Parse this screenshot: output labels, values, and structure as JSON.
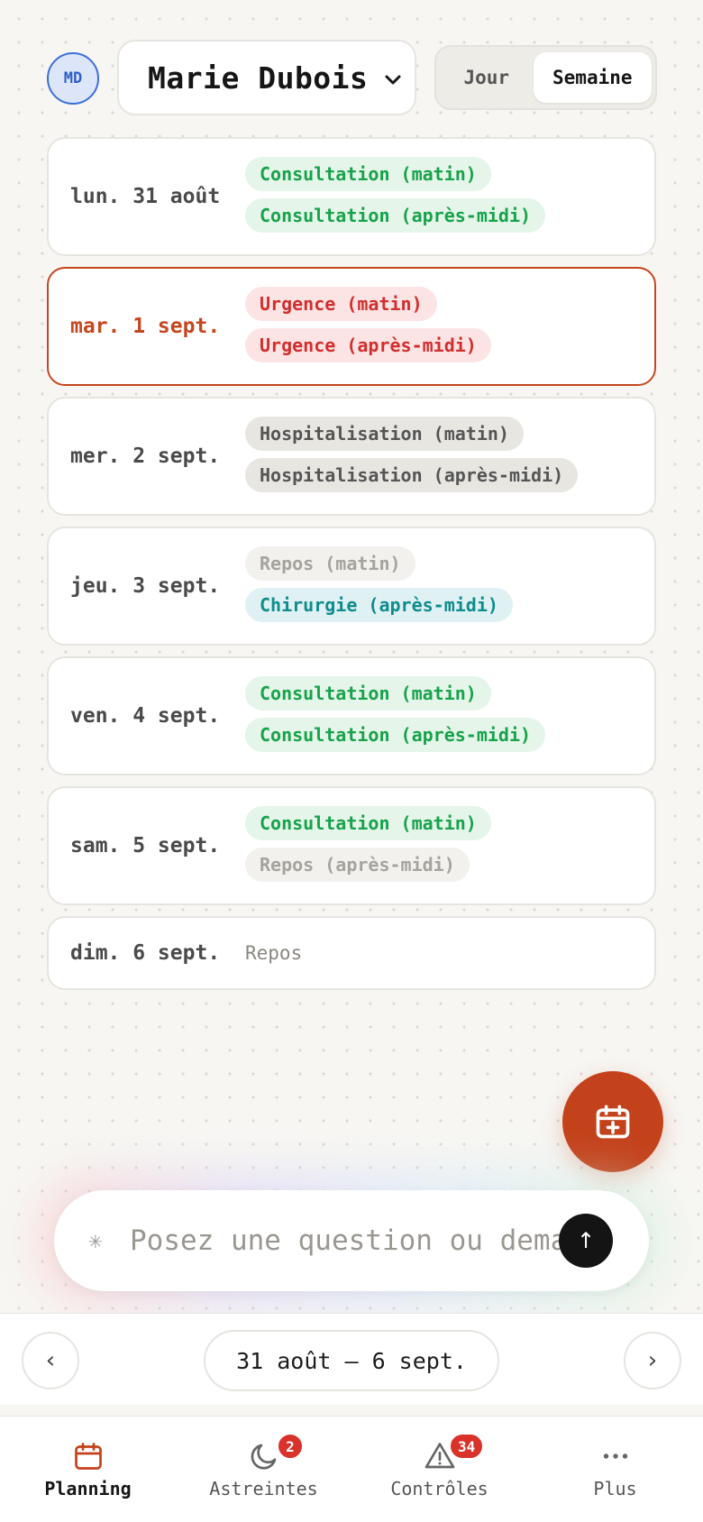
{
  "header": {
    "avatar_initials": "MD",
    "user_name": "Marie Dubois",
    "view_options": {
      "day": "Jour",
      "week": "Semaine"
    },
    "selected_view": "Semaine"
  },
  "days": [
    {
      "label": "lun. 31 août",
      "chips": [
        {
          "text": "Consultation (matin)",
          "kind": "green"
        },
        {
          "text": "Consultation (après-midi)",
          "kind": "green"
        }
      ]
    },
    {
      "label": "mar. 1 sept.",
      "today": true,
      "chips": [
        {
          "text": "Urgence (matin)",
          "kind": "red"
        },
        {
          "text": "Urgence (après-midi)",
          "kind": "red"
        }
      ]
    },
    {
      "label": "mer. 2 sept.",
      "chips": [
        {
          "text": "Hospitalisation (matin)",
          "kind": "grey"
        },
        {
          "text": "Hospitalisation (après-midi)",
          "kind": "grey"
        }
      ]
    },
    {
      "label": "jeu. 3 sept.",
      "chips": [
        {
          "text": "Repos (matin)",
          "kind": "light"
        },
        {
          "text": "Chirurgie (après-midi)",
          "kind": "teal"
        }
      ]
    },
    {
      "label": "ven. 4 sept.",
      "chips": [
        {
          "text": "Consultation (matin)",
          "kind": "green"
        },
        {
          "text": "Consultation (après-midi)",
          "kind": "green"
        }
      ]
    },
    {
      "label": "sam. 5 sept.",
      "chips": [
        {
          "text": "Consultation (matin)",
          "kind": "green"
        },
        {
          "text": "Repos (après-midi)",
          "kind": "light"
        }
      ]
    },
    {
      "label": "dim. 6 sept.",
      "rest_text": "Repos"
    }
  ],
  "chat": {
    "spark": "✳",
    "placeholder": "Posez une question ou demandez une action…",
    "send_glyph": "↑"
  },
  "week_nav": {
    "prev_glyph": "‹",
    "next_glyph": "›",
    "range": "31 août – 6 sept."
  },
  "tabs": [
    {
      "label": "Planning",
      "icon": "calendar-icon",
      "active": true
    },
    {
      "label": "Astreintes",
      "icon": "moon-icon",
      "badge": "2"
    },
    {
      "label": "Contrôles",
      "icon": "warning-icon",
      "badge": "34"
    },
    {
      "label": "Plus",
      "icon": "more-icon"
    }
  ],
  "colors": {
    "accent": "#c4421b",
    "green": "#16a34a",
    "red": "#d12e2e",
    "teal": "#0e8c8e",
    "badge": "#d8322b"
  }
}
